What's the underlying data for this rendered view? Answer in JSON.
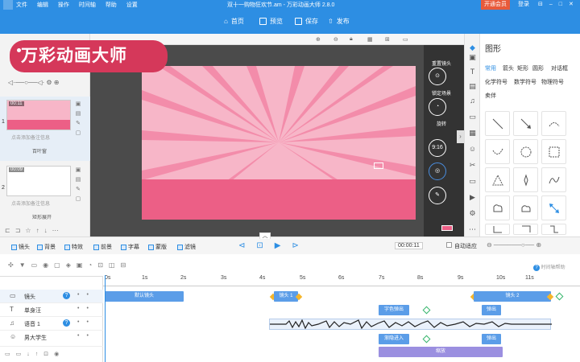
{
  "titlebar": {
    "menu": [
      "文件",
      "编辑",
      "操作",
      "时间轴",
      "帮助",
      "设置"
    ],
    "title": "双十一购物狂欢节.am - 万彩动画大师 2.8.0",
    "vip": "开通会员",
    "login": "登录"
  },
  "toolbar": {
    "home": "首页",
    "preview": "预览",
    "save": "保存",
    "publish": "发布"
  },
  "brand": "万彩动画大师",
  "scenes": [
    {
      "num": "1",
      "time": "00:11",
      "note": "点击添加备注信息",
      "transition": "百叶窗"
    },
    {
      "num": "2",
      "time": "00:09",
      "note": "点击添加备注信息",
      "transition": "矩形展开"
    }
  ],
  "camera_controls": {
    "add": "重置镜头",
    "lock": "锁定场景",
    "rotate": "旋转",
    "ratio": "9:16"
  },
  "right_panel": {
    "title": "图形",
    "categories_row1": [
      "常用",
      "箭头",
      "矩形",
      "圆形",
      "对话框"
    ],
    "categories_row2": [
      "化学符号",
      "数学符号",
      "物理符号"
    ],
    "categories_row3": [
      "卖伴"
    ]
  },
  "timeline_toolbar": {
    "items": [
      "镜头",
      "背景",
      "特效",
      "前景",
      "字幕",
      "蒙版",
      "滤镜"
    ],
    "time_value": "00:00:11",
    "auto_fit": "自动适应",
    "help": "时间轴帮助"
  },
  "ruler": [
    "0s",
    "1s",
    "2s",
    "3s",
    "4s",
    "5s",
    "6s",
    "7s",
    "8s",
    "9s",
    "10s",
    "11s"
  ],
  "tracks": [
    {
      "name": "镜头",
      "clips": [
        "默认镜头",
        "镜头 1",
        "镜头 2"
      ]
    },
    {
      "name": "单身汪",
      "clips": [
        "字色弹出",
        "弹出"
      ]
    },
    {
      "name": "语音 1",
      "clips": []
    },
    {
      "name": "男大学生",
      "clips": [
        "渐隐进入",
        "弹出"
      ]
    },
    {
      "name": "",
      "clips": [
        "缩放"
      ]
    }
  ]
}
